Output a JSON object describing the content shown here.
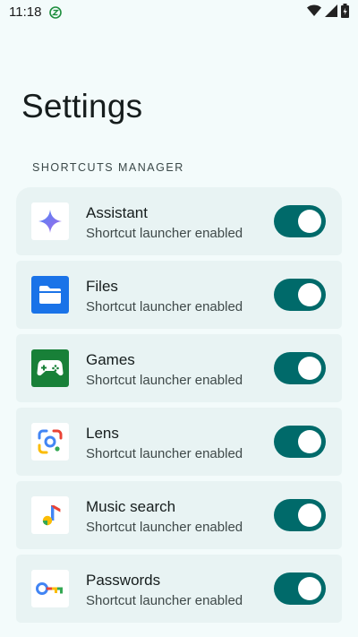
{
  "status_bar": {
    "time": "11:18",
    "app_icon": "z-icon",
    "icons": [
      "wifi-icon",
      "signal-icon",
      "battery-icon"
    ]
  },
  "page": {
    "title": "Settings",
    "section_header": "SHORTCUTS MANAGER"
  },
  "colors": {
    "background": "#f3fbfb",
    "card": "#e8f3f3",
    "toggle_on": "#006a6a",
    "knob": "#ffffff"
  },
  "items": [
    {
      "icon": "assistant-icon",
      "title": "Assistant",
      "subtitle": "Shortcut launcher enabled",
      "enabled": true
    },
    {
      "icon": "files-icon",
      "title": "Files",
      "subtitle": "Shortcut launcher enabled",
      "enabled": true
    },
    {
      "icon": "games-icon",
      "title": "Games",
      "subtitle": "Shortcut launcher enabled",
      "enabled": true
    },
    {
      "icon": "lens-icon",
      "title": "Lens",
      "subtitle": "Shortcut launcher enabled",
      "enabled": true
    },
    {
      "icon": "music-search-icon",
      "title": "Music search",
      "subtitle": "Shortcut launcher enabled",
      "enabled": true
    },
    {
      "icon": "passwords-icon",
      "title": "Passwords",
      "subtitle": "Shortcut launcher enabled",
      "enabled": true
    }
  ]
}
